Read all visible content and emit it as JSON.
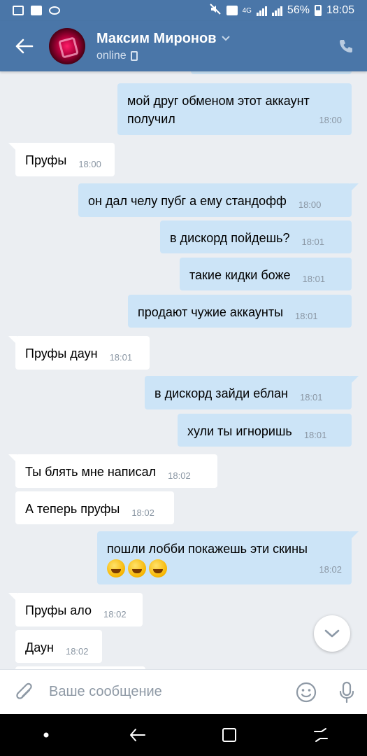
{
  "status_bar": {
    "battery": "56%",
    "time": "18:05",
    "network": "4G"
  },
  "header": {
    "name": "Максим Миронов",
    "status": "online"
  },
  "messages": [
    {
      "dir": "out",
      "text": "мой друг обменом этот аккаунт получил",
      "time": "18:00"
    },
    {
      "dir": "in",
      "text": "Пруфы",
      "time": "18:00"
    },
    {
      "dir": "out",
      "text": "он дал челу пубг а ему стандофф",
      "time": "18:00"
    },
    {
      "dir": "out",
      "text": "в дискорд пойдешь?",
      "time": "18:01"
    },
    {
      "dir": "out",
      "text": "такие кидки боже",
      "time": "18:01"
    },
    {
      "dir": "out",
      "text": "продают чужие аккаунты",
      "time": "18:01"
    },
    {
      "dir": "in",
      "text": "Пруфы даун",
      "time": "18:01"
    },
    {
      "dir": "out",
      "text": "в дискорд зайди еблан",
      "time": "18:01"
    },
    {
      "dir": "out",
      "text": "хули ты игноришь",
      "time": "18:01"
    },
    {
      "dir": "in",
      "text": "Ты блять мне написал",
      "time": "18:02"
    },
    {
      "dir": "in",
      "text": "А теперь пруфы",
      "time": "18:02"
    },
    {
      "dir": "out",
      "text": "пошли лобби покажешь эти скины",
      "time": "18:02",
      "emojis": [
        "rofl-emoji",
        "rofl-emoji",
        "rofl-emoji"
      ]
    },
    {
      "dir": "in",
      "text": "Пруфы ало",
      "time": "18:02"
    },
    {
      "dir": "in",
      "text": "Даун",
      "time": "18:02"
    }
  ],
  "composer": {
    "placeholder": "Ваше сообщение"
  },
  "icons": {
    "back": "back-arrow-icon",
    "call": "phone-icon",
    "attach": "paperclip-icon",
    "emoji": "smiley-icon",
    "mic": "microphone-icon",
    "scroll": "chevron-down-icon"
  },
  "colors": {
    "header": "#4a76a8",
    "outgoing_bubble": "#cce4f7",
    "incoming_bubble": "#ffffff",
    "background": "#ebeef2"
  }
}
